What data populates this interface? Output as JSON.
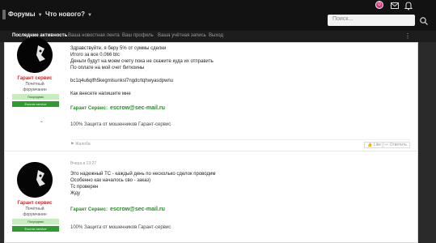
{
  "nav": {
    "forums_label": "Форумы",
    "whats_new_label": "Что нового?",
    "search_placeholder": "Поиск..."
  },
  "user_menu": {
    "notification_count": "0"
  },
  "subnav": {
    "items": [
      "Последние активность",
      "Ваша новостная лента",
      "Ваш профиль",
      "Ваша учётная запись",
      "Выход"
    ]
  },
  "posts": [
    {
      "author": "Гарант сервис",
      "author_title_line1": "Почётный",
      "author_title_line2": "форумчанин",
      "badge_light": "Посредник",
      "badge_dark": "Escrow service",
      "lines": [
        "Здравствуйте, я беру 5% от суммы сделки",
        "Итого за все 0.066 btc",
        "Деньги будут на моем счету пока не скажите куда их отправить",
        "По оплате на мой счет биткоины",
        "",
        "bc1q4u6qlfh5kegmlsunksl7ngdcrtqhwyasdpwnu",
        "",
        "Как внесете напишите мне"
      ],
      "signature_prefix": "Гарант Сервис:",
      "signature_email": "escrow@sec-mail.ru",
      "footer": "100% Защита от мошенников Гарант-сервис",
      "report_label": "Жалоба",
      "like_label": "Like",
      "reply_label": "Ответить"
    },
    {
      "time": "Вчера в 13:27",
      "author": "Гарант сервис",
      "author_title_line1": "Почётный",
      "author_title_line2": "форумчанин",
      "badge_light": "Посредник",
      "badge_dark": "Escrow service",
      "lines": [
        "Это надежный ТС - каждый день по несколько сделок проводим",
        "Особенно как началось сво - заказ)",
        "Тс проверен",
        "Жду"
      ],
      "signature_prefix": "Гарант Сервис:",
      "signature_email": "escrow@sec-mail.ru",
      "footer": "100% Защита от мошенников Гарант-сервис"
    }
  ]
}
